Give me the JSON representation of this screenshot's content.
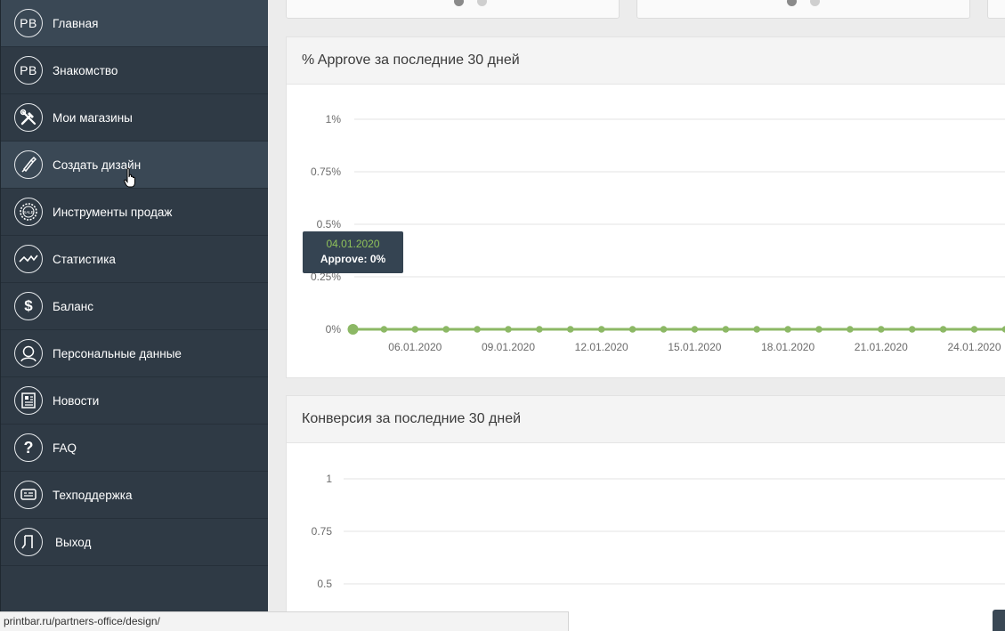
{
  "sidebar": {
    "items": [
      {
        "label": "Главная",
        "icon": "pb-logo-icon"
      },
      {
        "label": "Знакомство",
        "icon": "pb-logo-icon"
      },
      {
        "label": "Мои магазины",
        "icon": "tools-icon"
      },
      {
        "label": "Создать дизайн",
        "icon": "brush-icon"
      },
      {
        "label": "Инструменты продаж",
        "icon": "sale-badge-icon"
      },
      {
        "label": "Статистика",
        "icon": "line-chart-icon"
      },
      {
        "label": "Баланс",
        "icon": "dollar-icon"
      },
      {
        "label": "Персональные данные",
        "icon": "user-icon"
      },
      {
        "label": "Новости",
        "icon": "newspaper-icon"
      },
      {
        "label": "FAQ",
        "icon": "question-icon"
      },
      {
        "label": "Техподдержка",
        "icon": "support-chat-icon"
      },
      {
        "label": "Выход",
        "icon": "exit-door-icon"
      }
    ],
    "logo_text": "PB",
    "question_mark": "?",
    "dollar_sign": "$"
  },
  "colors": {
    "sidebar_bg": "#2f3a45",
    "sidebar_hover": "#3a4855",
    "series_green": "#8cb865",
    "tooltip_bg": "#354452"
  },
  "approve_panel": {
    "title": "% Approve за последние 30 дней",
    "tooltip": {
      "date": "04.01.2020",
      "value": "Approve: 0%"
    }
  },
  "conversion_panel": {
    "title": "Конверсия за последние 30 дней"
  },
  "chart_data": [
    {
      "type": "line",
      "title": "% Approve за последние 30 дней",
      "ylim": [
        0,
        1
      ],
      "y_ticks": [
        "0%",
        "0.25%",
        "0.5%",
        "0.75%",
        "1%"
      ],
      "x_tick_labels": [
        "06.01.2020",
        "09.01.2020",
        "12.01.2020",
        "15.01.2020",
        "18.01.2020",
        "21.01.2020",
        "24.01.2020"
      ],
      "x": [
        "04.01.2020",
        "05.01.2020",
        "06.01.2020",
        "07.01.2020",
        "08.01.2020",
        "09.01.2020",
        "10.01.2020",
        "11.01.2020",
        "12.01.2020",
        "13.01.2020",
        "14.01.2020",
        "15.01.2020",
        "16.01.2020",
        "17.01.2020",
        "18.01.2020",
        "19.01.2020",
        "20.01.2020",
        "21.01.2020",
        "22.01.2020",
        "23.01.2020",
        "24.01.2020",
        "25.01.2020"
      ],
      "series": [
        {
          "values": [
            0,
            0,
            0,
            0,
            0,
            0,
            0,
            0,
            0,
            0,
            0,
            0,
            0,
            0,
            0,
            0,
            0,
            0,
            0,
            0,
            0,
            0
          ]
        }
      ],
      "grid": true,
      "highlighted_point": "04.01.2020"
    },
    {
      "type": "line",
      "title": "Конверсия за последние 30 дней",
      "y_ticks_visible": [
        "0.5",
        "0.75",
        "1"
      ],
      "grid": true
    }
  ],
  "status_bar": {
    "url": "printbar.ru/partners-office/design/"
  }
}
